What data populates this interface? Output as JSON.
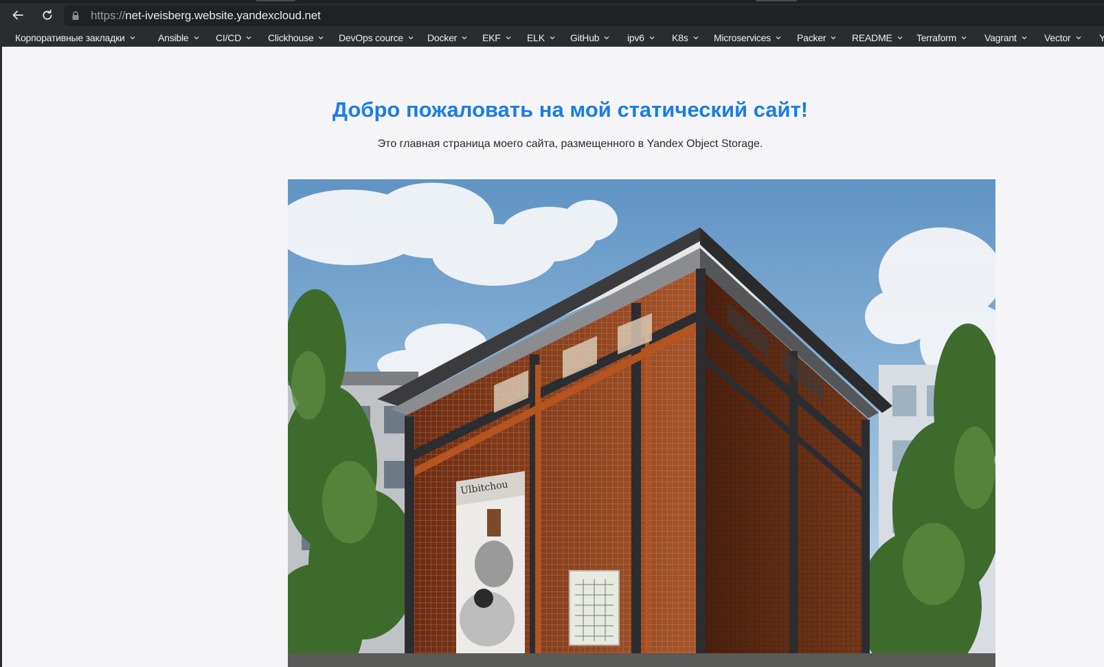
{
  "browser": {
    "url_scheme": "https://",
    "url_host": "net-iveisberg.website.yandexcloud.net",
    "icons": {
      "back": "arrow-left-icon",
      "reload": "reload-icon",
      "lock": "lock-icon",
      "dropdown": "chevron-down-icon"
    }
  },
  "bookmarks": [
    {
      "label": "Корпоративные закладки"
    },
    {
      "label": "Ansible"
    },
    {
      "label": "CI/CD"
    },
    {
      "label": "Clickhouse"
    },
    {
      "label": "DevOps cource"
    },
    {
      "label": "Docker"
    },
    {
      "label": "EKF"
    },
    {
      "label": "ELK"
    },
    {
      "label": "GitHub"
    },
    {
      "label": "ipv6"
    },
    {
      "label": "K8s"
    },
    {
      "label": "Microservices"
    },
    {
      "label": "Packer"
    },
    {
      "label": "README"
    },
    {
      "label": "Terraform"
    },
    {
      "label": "Vagrant"
    },
    {
      "label": "Vector"
    },
    {
      "label": "Y"
    }
  ],
  "page": {
    "title": "Добро пожаловать на мой статический сайт!",
    "subtitle": "Это главная страница моего сайта, размещенного в Yandex Object Storage."
  },
  "colors": {
    "title": "#1a7de6",
    "chrome": "#2b2c30",
    "page_bg": "#f5f5f7"
  }
}
